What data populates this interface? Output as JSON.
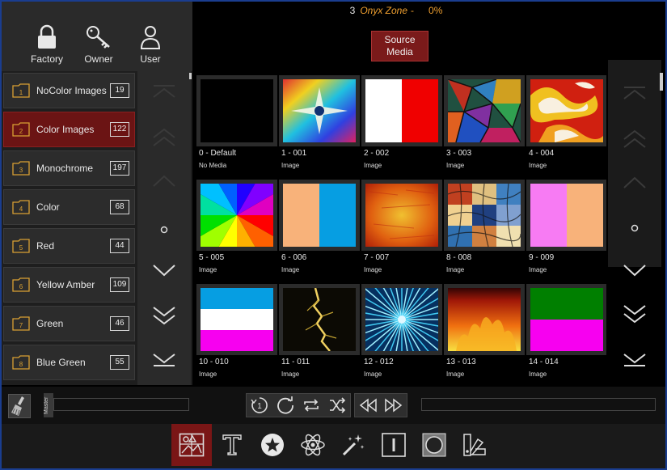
{
  "header": {
    "number": "3",
    "zone": "Onyx Zone",
    "dash": "-",
    "percent": "0%"
  },
  "source_button": {
    "line1": "Source",
    "line2": "Media"
  },
  "libraries": [
    {
      "label": "Factory",
      "icon": "lock-icon"
    },
    {
      "label": "Owner",
      "icon": "key-icon"
    },
    {
      "label": "User",
      "icon": "user-icon"
    }
  ],
  "folders": [
    {
      "num": "1",
      "name": "NoColor Images",
      "count": "19",
      "active": false
    },
    {
      "num": "2",
      "name": "Color Images",
      "count": "122",
      "active": true
    },
    {
      "num": "3",
      "name": "Monochrome",
      "count": "197",
      "active": false
    },
    {
      "num": "4",
      "name": "Color",
      "count": "68",
      "active": false
    },
    {
      "num": "5",
      "name": "Red",
      "count": "44",
      "active": false
    },
    {
      "num": "6",
      "name": "Yellow Amber",
      "count": "109",
      "active": false
    },
    {
      "num": "7",
      "name": "Green",
      "count": "46",
      "active": false
    },
    {
      "num": "8",
      "name": "Blue Green",
      "count": "55",
      "active": false
    }
  ],
  "media": [
    {
      "label": "0 - Default",
      "type": "No Media",
      "thumb": "empty"
    },
    {
      "label": "1 - 001",
      "type": "Image",
      "thumb": "rainbow-star"
    },
    {
      "label": "2 - 002",
      "type": "Image",
      "thumb": "white-red"
    },
    {
      "label": "3 - 003",
      "type": "Image",
      "thumb": "stained-glass"
    },
    {
      "label": "4 - 004",
      "type": "Image",
      "thumb": "psychedelic"
    },
    {
      "label": "5 - 005",
      "type": "Image",
      "thumb": "color-wheel"
    },
    {
      "label": "6 - 006",
      "type": "Image",
      "thumb": "peach-blue"
    },
    {
      "label": "7 - 007",
      "type": "Image",
      "thumb": "orange-grunge"
    },
    {
      "label": "8 - 008",
      "type": "Image",
      "thumb": "mosaic"
    },
    {
      "label": "9 - 009",
      "type": "Image",
      "thumb": "pink-peach"
    },
    {
      "label": "10 - 010",
      "type": "Image",
      "thumb": "blue-white-magenta"
    },
    {
      "label": "11 - 011",
      "type": "Image",
      "thumb": "lightning"
    },
    {
      "label": "12 - 012",
      "type": "Image",
      "thumb": "blue-burst"
    },
    {
      "label": "13 - 013",
      "type": "Image",
      "thumb": "fire"
    },
    {
      "label": "14 - 014",
      "type": "Image",
      "thumb": "green-magenta"
    }
  ],
  "controls": {
    "master_label": "Master"
  },
  "tabs": [
    {
      "name": "media-tab",
      "active": true
    },
    {
      "name": "text-tab",
      "active": false
    },
    {
      "name": "star-tab",
      "active": false
    },
    {
      "name": "atom-tab",
      "active": false
    },
    {
      "name": "effects-tab",
      "active": false
    },
    {
      "name": "bar-tab",
      "active": false
    },
    {
      "name": "mask-tab",
      "active": false
    },
    {
      "name": "color-palette-tab",
      "active": false
    }
  ],
  "colors": {
    "accent_red": "#7a1616",
    "header_orange": "#f0a030",
    "frame_blue": "#1a3d8f"
  }
}
